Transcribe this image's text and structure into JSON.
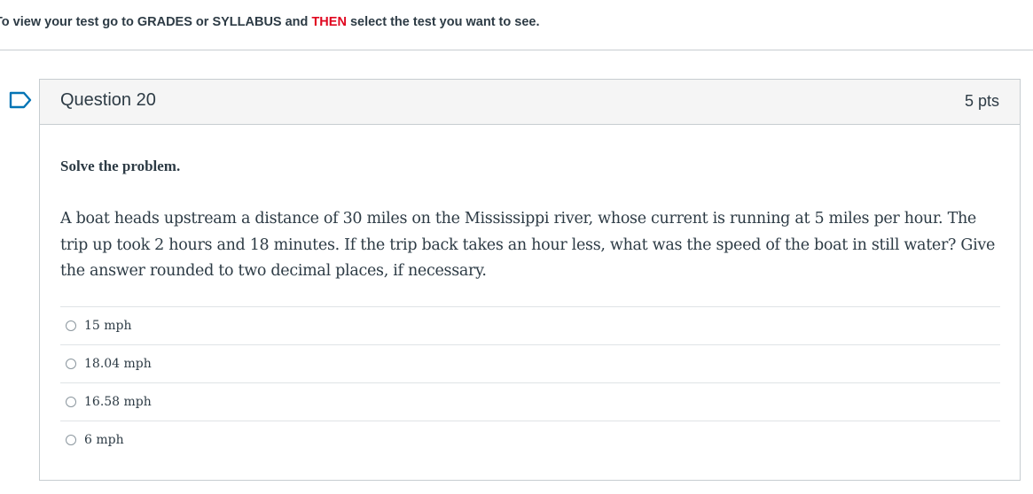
{
  "banner": {
    "part1": "To view your test go to GRADES or SYLLABUS and ",
    "highlight": "THEN",
    "part2": " select the test you want to see."
  },
  "question": {
    "title": "Question 20",
    "points": "5 pts",
    "instruction": "Solve the problem.",
    "text": "A boat heads upstream a distance of 30 miles on the Mississippi river, whose current is running at 5 miles per hour. The trip up took 2 hours and 18 minutes.  If the trip back takes an hour less, what was the speed of the boat in still water? Give the answer rounded to two decimal places, if necessary.",
    "answers": [
      {
        "label": "15 mph"
      },
      {
        "label": "18.04 mph"
      },
      {
        "label": "16.58 mph"
      },
      {
        "label": "6 mph"
      }
    ]
  },
  "colors": {
    "highlight": "#e0061f",
    "text": "#2d3b45",
    "header_bg": "#f5f5f5",
    "border": "#c7cdd1",
    "flag": "#0374b5"
  },
  "icons": {
    "flag": "flag-question-icon"
  }
}
